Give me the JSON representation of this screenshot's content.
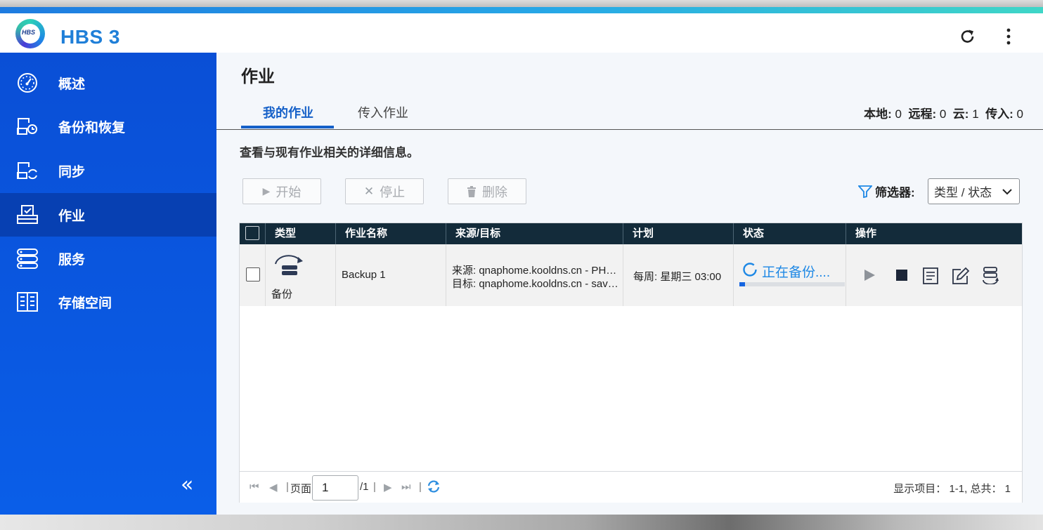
{
  "app": {
    "title": "HBS 3",
    "logo_text": "HBS"
  },
  "sidebar": {
    "items": [
      {
        "label": "概述",
        "icon": "gauge-icon"
      },
      {
        "label": "备份和恢复",
        "icon": "backup-restore-icon"
      },
      {
        "label": "同步",
        "icon": "sync-icon"
      },
      {
        "label": "作业",
        "icon": "job-icon",
        "active": true
      },
      {
        "label": "服务",
        "icon": "services-icon"
      },
      {
        "label": "存储空间",
        "icon": "storage-icon"
      }
    ],
    "collapse_label": "«"
  },
  "main": {
    "title": "作业",
    "tabs": [
      {
        "label": "我的作业",
        "active": true
      },
      {
        "label": "传入作业"
      }
    ],
    "counts": {
      "local_label": "本地:",
      "local": "0",
      "remote_label": "远程:",
      "remote": "0",
      "cloud_label": "云:",
      "cloud": "1",
      "incoming_label": "传入:",
      "incoming": "0"
    },
    "description": "查看与现有作业相关的详细信息。",
    "toolbar": {
      "start_label": "开始",
      "stop_label": "停止",
      "delete_label": "删除"
    },
    "filter": {
      "label": "筛选器:",
      "selected": "类型 / 状态"
    }
  },
  "table": {
    "headers": [
      "类型",
      "作业名称",
      "来源/目标",
      "计划",
      "状态",
      "操作"
    ],
    "rows": [
      {
        "type": "备份",
        "name": "Backup 1",
        "source": "来源: qnaphome.kooldns.cn - PH…",
        "target": "目标: qnaphome.kooldns.cn - sav…",
        "schedule": "每周: 星期三 03:00",
        "status": "正在备份....",
        "progress": 0.05
      }
    ]
  },
  "pagination": {
    "page_label": "页面",
    "page_value": "1",
    "total_pages": "/1",
    "shown_text": "显示项目：  1-1, 总共：  1"
  },
  "colors": {
    "accent": "#1560c8",
    "sidebar": "#0a56e0",
    "header": "#132b3a",
    "status_blue": "#1e88e5"
  }
}
